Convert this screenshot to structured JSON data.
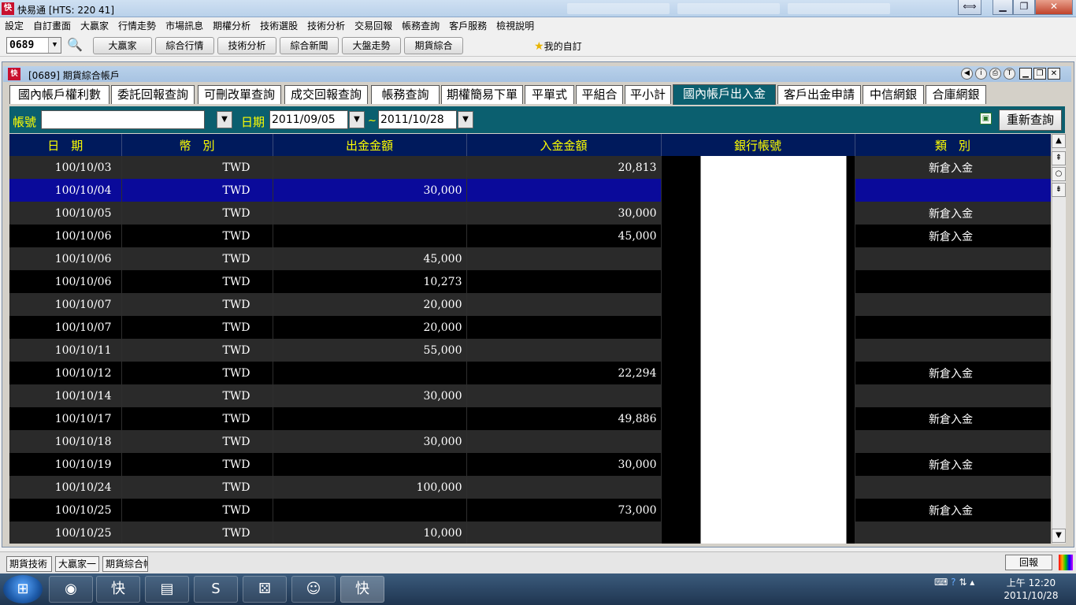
{
  "app": {
    "title": "快易通 [HTS: 220 41]",
    "logo": "快"
  },
  "menu": [
    "設定",
    "自訂畫面",
    "大贏家",
    "行情走勢",
    "市場訊息",
    "期權分析",
    "技術選股",
    "技術分析",
    "交易回報",
    "帳務查詢",
    "客戶服務",
    "檢視說明"
  ],
  "toolbar": {
    "stock_code": "0689",
    "buttons": [
      "大贏家",
      "綜合行情",
      "技術分析",
      "綜合新聞",
      "大盤走勢",
      "期貨綜合"
    ],
    "favorites": "我的自訂"
  },
  "child": {
    "title": "[0689] 期貨綜合帳戶"
  },
  "tabs": [
    "國內帳戶權利數",
    "委託回報查詢",
    "可刪改單查詢",
    "成交回報查詢",
    "帳務查詢",
    "期權簡易下單",
    "平單式",
    "平組合",
    "平小計",
    "國內帳戶出入金",
    "客戶出金申請",
    "中信網銀",
    "合庫網銀"
  ],
  "active_tab": "國內帳戶出入金",
  "filter": {
    "account_label": "帳號",
    "account_value": "",
    "date_label": "日期",
    "date_from": "2011/09/05",
    "tilde": "~",
    "date_to": "2011/10/28",
    "refresh": "重新查詢"
  },
  "table": {
    "headers": [
      "日　期",
      "幣　別",
      "出金金額",
      "入金金額",
      "銀行帳號",
      "類　別"
    ],
    "rows": [
      [
        "100/10/03",
        "TWD",
        "",
        "20,813",
        "",
        "新倉入金"
      ],
      [
        "100/10/04",
        "TWD",
        "30,000",
        "",
        "",
        ""
      ],
      [
        "100/10/05",
        "TWD",
        "",
        "30,000",
        "",
        "新倉入金"
      ],
      [
        "100/10/06",
        "TWD",
        "",
        "45,000",
        "",
        "新倉入金"
      ],
      [
        "100/10/06",
        "TWD",
        "45,000",
        "",
        "",
        ""
      ],
      [
        "100/10/06",
        "TWD",
        "10,273",
        "",
        "",
        ""
      ],
      [
        "100/10/07",
        "TWD",
        "20,000",
        "",
        "",
        ""
      ],
      [
        "100/10/07",
        "TWD",
        "20,000",
        "",
        "",
        ""
      ],
      [
        "100/10/11",
        "TWD",
        "55,000",
        "",
        "",
        ""
      ],
      [
        "100/10/12",
        "TWD",
        "",
        "22,294",
        "",
        "新倉入金"
      ],
      [
        "100/10/14",
        "TWD",
        "30,000",
        "",
        "",
        ""
      ],
      [
        "100/10/17",
        "TWD",
        "",
        "49,886",
        "",
        "新倉入金"
      ],
      [
        "100/10/18",
        "TWD",
        "30,000",
        "",
        "",
        ""
      ],
      [
        "100/10/19",
        "TWD",
        "",
        "30,000",
        "",
        "新倉入金"
      ],
      [
        "100/10/24",
        "TWD",
        "100,000",
        "",
        "",
        ""
      ],
      [
        "100/10/25",
        "TWD",
        "",
        "73,000",
        "",
        "新倉入金"
      ],
      [
        "100/10/25",
        "TWD",
        "10,000",
        "",
        "",
        ""
      ]
    ],
    "selected_row": 1
  },
  "docbar": {
    "items": [
      "期貨技術",
      "大贏家一",
      "期貨綜合帳戶"
    ],
    "return_label": "回報"
  },
  "taskbar": {
    "clock_time": "上午 12:20",
    "clock_date": "2011/10/28"
  },
  "colors": {
    "accent_teal": "#0b5f6f",
    "header_navy": "#001a5c",
    "header_text": "#ffff00",
    "selected": "#0a0a9a"
  }
}
